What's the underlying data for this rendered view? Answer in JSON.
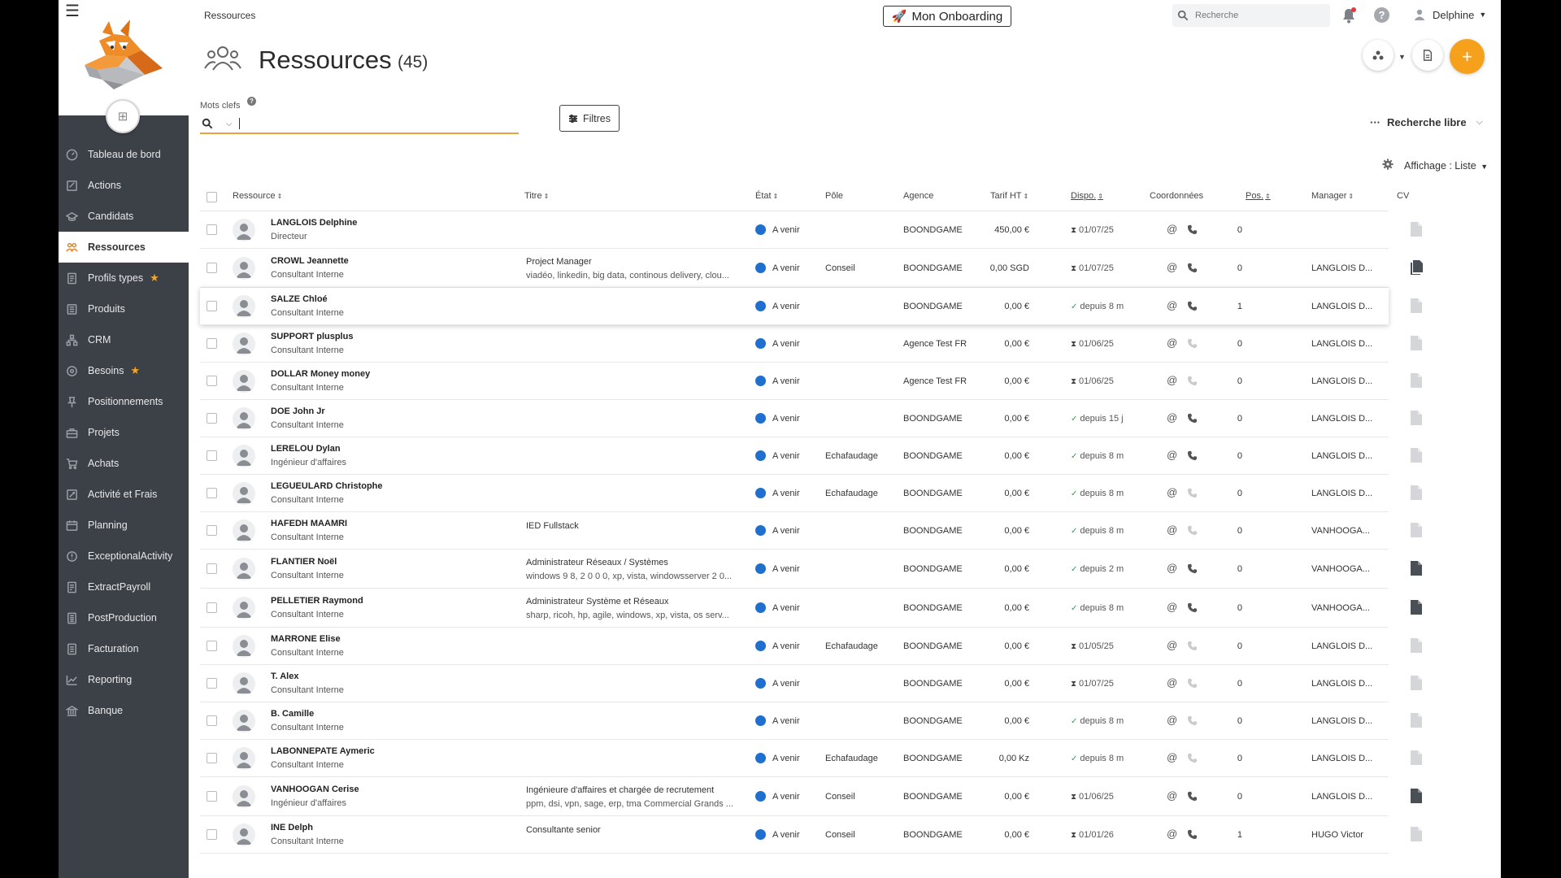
{
  "breadcrumb": "Ressources",
  "header": {
    "onboarding_label": "Mon Onboarding",
    "search_placeholder": "Recherche",
    "user_name": "Delphine"
  },
  "sidebar": {
    "items": [
      {
        "label": "Tableau de bord",
        "icon": "dashboard-icon",
        "active": false,
        "star": false
      },
      {
        "label": "Actions",
        "icon": "actions-icon",
        "active": false,
        "star": false
      },
      {
        "label": "Candidats",
        "icon": "candidates-icon",
        "active": false,
        "star": false
      },
      {
        "label": "Ressources",
        "icon": "users-icon",
        "active": true,
        "star": false
      },
      {
        "label": "Profils types",
        "icon": "profiles-icon",
        "active": false,
        "star": true
      },
      {
        "label": "Produits",
        "icon": "products-icon",
        "active": false,
        "star": false
      },
      {
        "label": "CRM",
        "icon": "crm-icon",
        "active": false,
        "star": false
      },
      {
        "label": "Besoins",
        "icon": "needs-icon",
        "active": false,
        "star": true
      },
      {
        "label": "Positionnements",
        "icon": "pin-icon",
        "active": false,
        "star": false
      },
      {
        "label": "Projets",
        "icon": "briefcase-icon",
        "active": false,
        "star": false
      },
      {
        "label": "Achats",
        "icon": "cart-icon",
        "active": false,
        "star": false
      },
      {
        "label": "Activité et Frais",
        "icon": "activity-icon",
        "active": false,
        "star": false
      },
      {
        "label": "Planning",
        "icon": "calendar-icon",
        "active": false,
        "star": false
      },
      {
        "label": "ExceptionalActivity",
        "icon": "exceptional-icon",
        "active": false,
        "star": false
      },
      {
        "label": "ExtractPayroll",
        "icon": "payroll-icon",
        "active": false,
        "star": false
      },
      {
        "label": "PostProduction",
        "icon": "postproduction-icon",
        "active": false,
        "star": false
      },
      {
        "label": "Facturation",
        "icon": "invoice-icon",
        "active": false,
        "star": false
      },
      {
        "label": "Reporting",
        "icon": "chart-icon",
        "active": false,
        "star": false
      },
      {
        "label": "Banque",
        "icon": "bank-icon",
        "active": false,
        "star": false
      }
    ]
  },
  "page": {
    "title": "Ressources",
    "count": "(45)"
  },
  "search": {
    "keywords_label": "Mots clefs",
    "keywords_value": "",
    "filters_label": "Filtres",
    "free_search_label": "Recherche libre",
    "display_label": "Affichage : Liste"
  },
  "colors": {
    "accent": "#f5a11c",
    "sidebar_bg": "#3c4047",
    "state_blue": "#1f6fce",
    "keyword_underline": "#e8a23a"
  },
  "table": {
    "headers": {
      "resource": "Ressource",
      "title": "Titre",
      "state": "État",
      "pole": "Pôle",
      "agency": "Agence",
      "rate": "Tarif HT",
      "dispo": "Dispo.",
      "contact": "Coordonnées",
      "pos": "Pos.",
      "manager": "Manager",
      "cv": "CV"
    },
    "rows": [
      {
        "name": "LANGLOIS Delphine",
        "role": "Directeur",
        "title": "",
        "skills": "",
        "state": "A venir",
        "pole": "",
        "agency": "BOONDGAME",
        "rate": "450,00 €",
        "dispo_type": "hourglass",
        "dispo": "01/07/25",
        "phone_active": true,
        "pos": "0",
        "manager": "",
        "cv": "empty"
      },
      {
        "name": "CROWL Jeannette",
        "role": "Consultant Interne",
        "title": "Project Manager",
        "skills": "viadéo, linkedin, big data, continous delivery, clou...",
        "state": "A venir",
        "pole": "Conseil",
        "agency": "BOONDGAME",
        "rate": "0,00 SGD",
        "dispo_type": "hourglass",
        "dispo": "01/07/25",
        "phone_active": true,
        "pos": "0",
        "manager": "LANGLOIS D...",
        "cv": "multi"
      },
      {
        "name": "SALZE Chloé",
        "role": "Consultant Interne",
        "title": "",
        "skills": "",
        "state": "A venir",
        "pole": "",
        "agency": "BOONDGAME",
        "rate": "0,00 €",
        "dispo_type": "check",
        "dispo": "depuis 8 m",
        "phone_active": true,
        "pos": "1",
        "manager": "LANGLOIS D...",
        "cv": "empty"
      },
      {
        "name": "SUPPORT plusplus",
        "role": "Consultant Interne",
        "title": "",
        "skills": "",
        "state": "A venir",
        "pole": "",
        "agency": "Agence Test FR",
        "rate": "0,00 €",
        "dispo_type": "hourglass",
        "dispo": "01/06/25",
        "phone_active": false,
        "pos": "0",
        "manager": "LANGLOIS D...",
        "cv": "empty"
      },
      {
        "name": "DOLLAR Money money",
        "role": "Consultant Interne",
        "title": "",
        "skills": "",
        "state": "A venir",
        "pole": "",
        "agency": "Agence Test FR",
        "rate": "0,00 €",
        "dispo_type": "hourglass",
        "dispo": "01/06/25",
        "phone_active": false,
        "pos": "0",
        "manager": "LANGLOIS D...",
        "cv": "empty"
      },
      {
        "name": "DOE John Jr",
        "role": "Consultant Interne",
        "title": "",
        "skills": "",
        "state": "A venir",
        "pole": "",
        "agency": "BOONDGAME",
        "rate": "0,00 €",
        "dispo_type": "check",
        "dispo": "depuis 15 j",
        "phone_active": true,
        "pos": "0",
        "manager": "LANGLOIS D...",
        "cv": "empty"
      },
      {
        "name": "LERELOU Dylan",
        "role": "Ingénieur d'affaires",
        "title": "",
        "skills": "",
        "state": "A venir",
        "pole": "Echafaudage",
        "agency": "BOONDGAME",
        "rate": "0,00 €",
        "dispo_type": "check",
        "dispo": "depuis 8 m",
        "phone_active": true,
        "pos": "0",
        "manager": "LANGLOIS D...",
        "cv": "empty"
      },
      {
        "name": "LEGUEULARD Christophe",
        "role": "Consultant Interne",
        "title": "",
        "skills": "",
        "state": "A venir",
        "pole": "Echafaudage",
        "agency": "BOONDGAME",
        "rate": "0,00 €",
        "dispo_type": "check",
        "dispo": "depuis 8 m",
        "phone_active": false,
        "pos": "0",
        "manager": "LANGLOIS D...",
        "cv": "empty"
      },
      {
        "name": "HAFEDH MAAMRI",
        "role": "Consultant Interne",
        "title": "IED Fullstack",
        "skills": "",
        "state": "A venir",
        "pole": "",
        "agency": "BOONDGAME",
        "rate": "0,00 €",
        "dispo_type": "check",
        "dispo": "depuis 8 m",
        "phone_active": false,
        "pos": "0",
        "manager": "VANHOOGA...",
        "cv": "empty"
      },
      {
        "name": "FLANTIER Noël",
        "role": "Consultant Interne",
        "title": "Administrateur Réseaux / Systèmes",
        "skills": "windows 9 8, 2 0 0 0, xp, vista, windowsserver 2 0...",
        "state": "A venir",
        "pole": "",
        "agency": "BOONDGAME",
        "rate": "0,00 €",
        "dispo_type": "check",
        "dispo": "depuis 2 m",
        "phone_active": true,
        "pos": "0",
        "manager": "VANHOOGA...",
        "cv": "filled"
      },
      {
        "name": "PELLETIER Raymond",
        "role": "Consultant Interne",
        "title": "Administrateur Système et Réseaux",
        "skills": "sharp, ricoh, hp, agile, windows, xp, vista, os serv...",
        "state": "A venir",
        "pole": "",
        "agency": "BOONDGAME",
        "rate": "0,00 €",
        "dispo_type": "check",
        "dispo": "depuis 8 m",
        "phone_active": true,
        "pos": "0",
        "manager": "VANHOOGA...",
        "cv": "filled"
      },
      {
        "name": "MARRONE Elise",
        "role": "Consultant Interne",
        "title": "",
        "skills": "",
        "state": "A venir",
        "pole": "Echafaudage",
        "agency": "BOONDGAME",
        "rate": "0,00 €",
        "dispo_type": "hourglass",
        "dispo": "01/05/25",
        "phone_active": false,
        "pos": "0",
        "manager": "LANGLOIS D...",
        "cv": "empty"
      },
      {
        "name": "T. Alex",
        "role": "Consultant Interne",
        "title": "",
        "skills": "",
        "state": "A venir",
        "pole": "",
        "agency": "BOONDGAME",
        "rate": "0,00 €",
        "dispo_type": "hourglass",
        "dispo": "01/07/25",
        "phone_active": false,
        "pos": "0",
        "manager": "LANGLOIS D...",
        "cv": "empty"
      },
      {
        "name": "B. Camille",
        "role": "Consultant Interne",
        "title": "",
        "skills": "",
        "state": "A venir",
        "pole": "",
        "agency": "BOONDGAME",
        "rate": "0,00 €",
        "dispo_type": "check",
        "dispo": "depuis 8 m",
        "phone_active": false,
        "pos": "0",
        "manager": "LANGLOIS D...",
        "cv": "empty"
      },
      {
        "name": "LABONNEPATE Aymeric",
        "role": "Consultant Interne",
        "title": "",
        "skills": "",
        "state": "A venir",
        "pole": "Echafaudage",
        "agency": "BOONDGAME",
        "rate": "0,00 Kz",
        "dispo_type": "check",
        "dispo": "depuis 8 m",
        "phone_active": false,
        "pos": "0",
        "manager": "LANGLOIS D...",
        "cv": "empty"
      },
      {
        "name": "VANHOOGAN Cerise",
        "role": "Ingénieur d'affaires",
        "title": "Ingénieure d'affaires et chargée de recrutement",
        "skills": "ppm, dsi, vpn, sage, erp, tma Commercial Grands ...",
        "state": "A venir",
        "pole": "Conseil",
        "agency": "BOONDGAME",
        "rate": "0,00 €",
        "dispo_type": "hourglass",
        "dispo": "01/06/25",
        "phone_active": true,
        "pos": "0",
        "manager": "LANGLOIS D...",
        "cv": "filled"
      },
      {
        "name": "INE Delph",
        "role": "Consultant Interne",
        "title": "Consultante senior",
        "skills": "",
        "state": "A venir",
        "pole": "Conseil",
        "agency": "BOONDGAME",
        "rate": "0,00 €",
        "dispo_type": "hourglass",
        "dispo": "01/01/26",
        "phone_active": true,
        "pos": "1",
        "manager": "HUGO Victor",
        "cv": "empty"
      }
    ]
  }
}
